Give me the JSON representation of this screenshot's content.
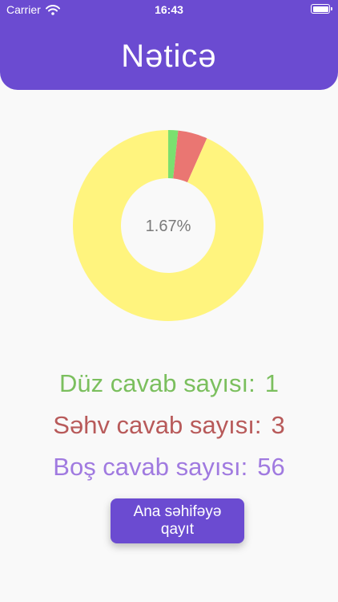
{
  "status_bar": {
    "carrier": "Carrier",
    "time": "16:43",
    "wifi_icon": "wifi-icon",
    "battery_icon": "battery-icon"
  },
  "header": {
    "title": "Nəticə",
    "color": "#6b4bd1"
  },
  "chart_data": {
    "type": "pie",
    "center_label": "1.67%",
    "slices": [
      {
        "label": "Düz",
        "value": 1,
        "color": "#7be06f"
      },
      {
        "label": "Səhv",
        "value": 3,
        "color": "#ea7672"
      },
      {
        "label": "Boş",
        "value": 56,
        "color": "#fff47e"
      }
    ]
  },
  "stats": {
    "correct": {
      "label": "Düz cavab sayısı:",
      "value": "1",
      "color": "#7bbf5e"
    },
    "wrong": {
      "label": "Səhv cavab sayısı:",
      "value": "3",
      "color": "#b85a5a"
    },
    "empty": {
      "label": "Boş cavab sayısı:",
      "value": "56",
      "color": "#a07ae0"
    }
  },
  "home_button": {
    "label": "Ana səhifəyə qayıt"
  }
}
